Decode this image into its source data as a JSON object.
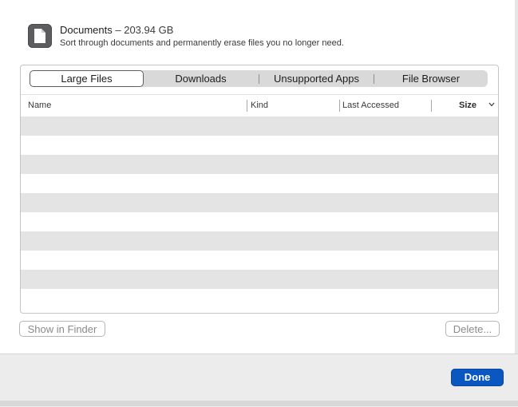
{
  "header": {
    "title": "Documents",
    "separator": " – ",
    "size": "203.94 GB",
    "subtitle": "Sort through documents and permanently erase files you no longer need.",
    "icon": "document-icon"
  },
  "tabs": [
    {
      "label": "Large Files",
      "selected": true
    },
    {
      "label": "Downloads",
      "selected": false
    },
    {
      "label": "Unsupported Apps",
      "selected": false
    },
    {
      "label": "File Browser",
      "selected": false
    }
  ],
  "table": {
    "columns": [
      "Name",
      "Kind",
      "Last Accessed",
      "Size"
    ],
    "sort_icon": "chevron-down-icon",
    "rows": []
  },
  "buttons": {
    "show_in_finder": "Show in Finder",
    "delete": "Delete...",
    "done": "Done"
  },
  "colors": {
    "accent": "#0a57c2",
    "stripe": "#e4e4e4"
  }
}
